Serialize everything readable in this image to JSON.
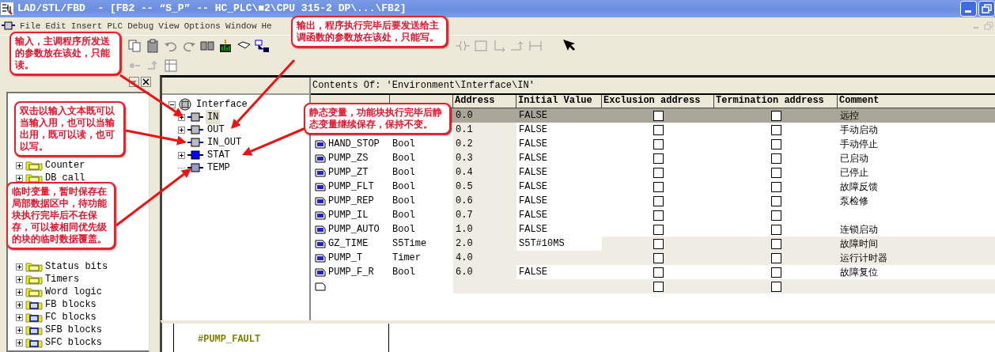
{
  "window": {
    "title": "LAD/STL/FBD  - [FB2 -- “S_P” -- HC_PLC\\■2\\CPU 315-2 DP\\...\\FB2]"
  },
  "menu": [
    "File",
    "Edit",
    "Insert",
    "PLC",
    "Debug",
    "View",
    "Options",
    "Window",
    "He"
  ],
  "palette": [
    {
      "items": [
        {
          "label": "Counter",
          "kind": "folder",
          "expandable": true
        },
        {
          "label": "DB call",
          "kind": "folder",
          "expandable": true
        }
      ]
    },
    {
      "items": [
        {
          "label": "Status bits",
          "kind": "folder",
          "expandable": true
        },
        {
          "label": "Timers",
          "kind": "folder",
          "expandable": true
        },
        {
          "label": "Word logic",
          "kind": "folder",
          "expandable": true
        },
        {
          "label": "FB blocks",
          "kind": "block",
          "expandable": true
        },
        {
          "label": "FC blocks",
          "kind": "block",
          "expandable": true
        },
        {
          "label": "SFB blocks",
          "kind": "block",
          "expandable": true
        },
        {
          "label": "SFC blocks",
          "kind": "block",
          "expandable": true
        }
      ]
    }
  ],
  "interface": {
    "label": "Interface",
    "expanded": true,
    "children": [
      {
        "label": "IN",
        "kind": "in",
        "expandable": true,
        "selected": true
      },
      {
        "label": "OUT",
        "kind": "out",
        "expandable": true,
        "selected": false
      },
      {
        "label": "IN_OUT",
        "kind": "inout",
        "expandable": false,
        "selected": false
      },
      {
        "label": "STAT",
        "kind": "stat",
        "expandable": true,
        "selected": false
      },
      {
        "label": "TEMP",
        "kind": "temp",
        "expandable": false,
        "selected": false
      }
    ]
  },
  "contents_path": "Contents Of: 'Environment\\Interface\\IN'",
  "table": {
    "columns": [
      "Address",
      "Initial Value",
      "Exclusion address",
      "Termination address",
      "Comment"
    ],
    "rows": [
      {
        "kind": "bool",
        "selected": true,
        "address": "0.0",
        "initial_value": "FALSE",
        "exclusion": false,
        "termination": false,
        "comment": "远控"
      },
      {
        "kind": "bool",
        "selected": false,
        "address": "0.1",
        "initial_value": "FALSE",
        "exclusion": false,
        "termination": false,
        "comment": "手动启动"
      },
      {
        "kind": "bool",
        "selected": false,
        "name": "HAND_STOP",
        "type": "Bool",
        "address": "0.2",
        "initial_value": "FALSE",
        "exclusion": false,
        "termination": false,
        "comment": "手动停止"
      },
      {
        "kind": "bool",
        "selected": false,
        "name": "PUMP_ZS",
        "type": "Bool",
        "address": "0.3",
        "initial_value": "FALSE",
        "exclusion": false,
        "termination": false,
        "comment": "已启动"
      },
      {
        "kind": "bool",
        "selected": false,
        "name": "PUMP_ZT",
        "type": "Bool",
        "address": "0.4",
        "initial_value": "FALSE",
        "exclusion": false,
        "termination": false,
        "comment": "已停止"
      },
      {
        "kind": "bool",
        "selected": false,
        "name": "PUMP_FLT",
        "type": "Bool",
        "address": "0.5",
        "initial_value": "FALSE",
        "exclusion": false,
        "termination": false,
        "comment": "故障反馈"
      },
      {
        "kind": "bool",
        "selected": false,
        "name": "PUMP_REP",
        "type": "Bool",
        "address": "0.6",
        "initial_value": "FALSE",
        "exclusion": false,
        "termination": false,
        "comment": "泵检修"
      },
      {
        "kind": "bool",
        "selected": false,
        "name": "PUMP_IL",
        "type": "Bool",
        "address": "0.7",
        "initial_value": "FALSE",
        "exclusion": false,
        "termination": false
      },
      {
        "kind": "bool",
        "selected": false,
        "name": "PUMP_AUTO",
        "type": "Bool",
        "address": "1.0",
        "initial_value": "FALSE",
        "exclusion": false,
        "termination": false,
        "comment": "连锁启动"
      },
      {
        "kind": "time",
        "selected": false,
        "name": "GZ_TIME",
        "type": "S5Time",
        "address": "2.0",
        "initial_value": "S5T#10MS",
        "exclusion": false,
        "termination": false,
        "comment": "故障时间"
      },
      {
        "kind": "timer",
        "selected": false,
        "name": "PUMP_T",
        "type": "Timer",
        "address": "4.0",
        "exclusion": false,
        "termination": false,
        "comment": "运行计时器"
      },
      {
        "kind": "bool",
        "selected": false,
        "name": "PUMP_F_R",
        "type": "Bool",
        "address": "6.0",
        "initial_value": "FALSE",
        "exclusion": false,
        "termination": false,
        "comment": "故障复位"
      },
      {
        "kind": "new",
        "selected": false,
        "exclusion": false,
        "termination": false
      }
    ]
  },
  "code": {
    "lines": [
      "#PUMP_FAULT"
    ]
  },
  "callouts": [
    {
      "text": "输出，程序执行完毕后要发送给主调函数的参数放在该处，只能写。"
    },
    {
      "text": "输入，主调程序所发送的参数放在该处，只能读。"
    },
    {
      "text": "双击以输入文本既可以当输入用，也可以当输出用，既可以读，也可以写。"
    },
    {
      "text": "静态变量，功能块执行完毕后静态变量继续保存，保持不变。"
    },
    {
      "text": "临时变量，暂时保存在局部数据区中，待功能块执行完毕后不在保存，可以被相同优先级的块的临时数据覆盖。"
    }
  ]
}
